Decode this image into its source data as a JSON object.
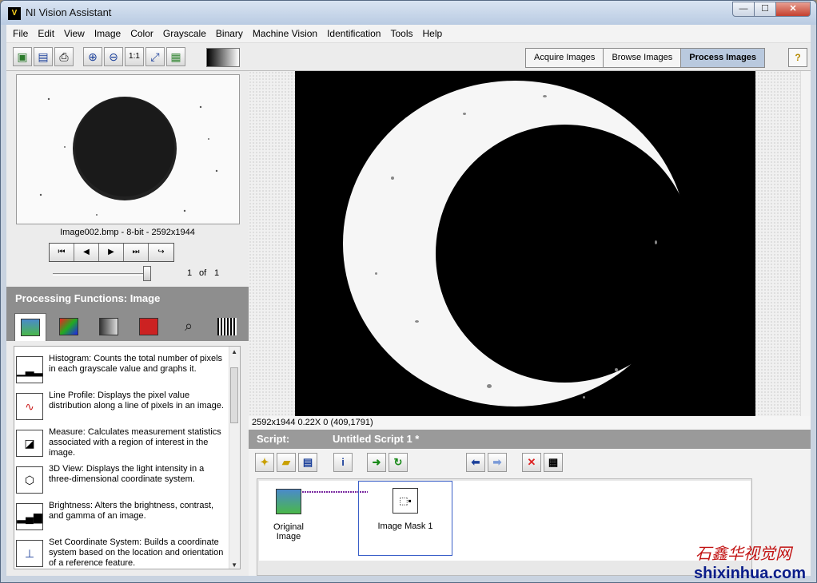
{
  "window": {
    "title": "NI Vision Assistant",
    "min": "—",
    "max": "☐",
    "close": "✕"
  },
  "menu": [
    "File",
    "Edit",
    "View",
    "Image",
    "Color",
    "Grayscale",
    "Binary",
    "Machine Vision",
    "Identification",
    "Tools",
    "Help"
  ],
  "toolbar_icons": [
    "open-image",
    "save-image",
    "print",
    "zoom-in",
    "zoom-out",
    "zoom-1to1",
    "zoom-fit",
    "palette",
    "gradient"
  ],
  "mode_tabs": [
    "Acquire Images",
    "Browse Images",
    "Process Images"
  ],
  "active_mode": "Process Images",
  "help_label": "?",
  "browser": {
    "file_label": "Image002.bmp - 8-bit - 2592x1944",
    "page_current": "1",
    "page_of": "of",
    "page_total": "1"
  },
  "processing": {
    "header": "Processing Functions: Image",
    "items": [
      {
        "title": "Histogram:",
        "desc": " Counts the total number of pixels in each grayscale value and graphs it."
      },
      {
        "title": "Line Profile:",
        "desc": " Displays the pixel value distribution along a line of pixels in an image."
      },
      {
        "title": "Measure:",
        "desc": " Calculates measurement statistics associated with a region of interest in the image."
      },
      {
        "title": "3D View:",
        "desc": " Displays the light intensity in a three-dimensional coordinate system."
      },
      {
        "title": "Brightness:",
        "desc": " Alters the brightness, contrast, and gamma of an image."
      },
      {
        "title": "Set Coordinate System:",
        "desc": " Builds a coordinate system based on the location and orientation of a reference feature."
      }
    ]
  },
  "viewer": {
    "status": "2592x1944 0.22X 0    (409,1791)"
  },
  "script": {
    "label": "Script:",
    "name": "Untitled Script 1 *",
    "steps": [
      "Original Image",
      "Image Mask 1"
    ]
  },
  "watermark": {
    "cn": "石鑫华视觉网",
    "url": "shixinhua.com"
  }
}
